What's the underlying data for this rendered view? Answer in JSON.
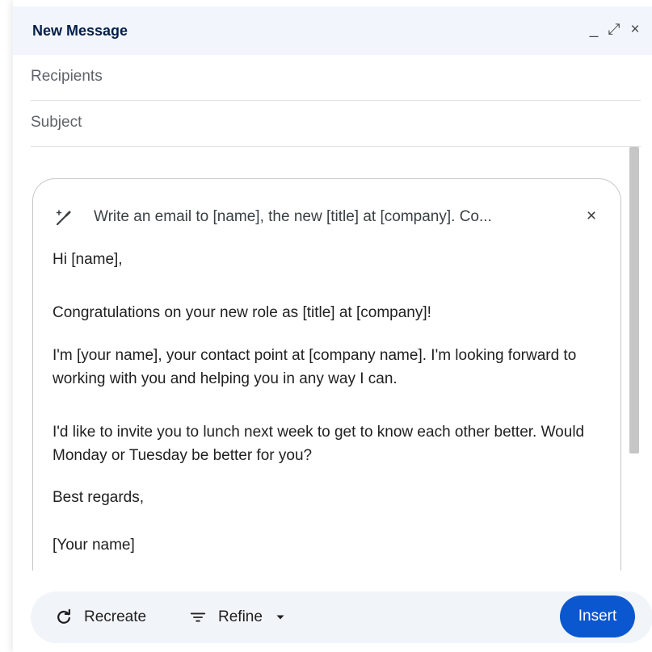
{
  "window": {
    "title": "New Message",
    "controls": {
      "minimize": "_",
      "expand": "⤢",
      "close": "×"
    }
  },
  "fields": {
    "recipients_placeholder": "Recipients",
    "subject_placeholder": "Subject"
  },
  "help_me_write": {
    "prompt": "Write an email to [name], the new [title] at [company]. Co...",
    "close": "×",
    "draft": [
      "Hi [name],",
      "Congratulations on your new role as [title] at [company]!",
      "I'm [your name], your contact point at [company name]. I'm looking forward to working with you and helping you in any way I can.",
      "I'd like to invite you to lunch next week to get to know each other better. Would Monday or Tuesday be better for you?",
      "Best regards,",
      "[Your name]"
    ]
  },
  "actions": {
    "recreate": "Recreate",
    "refine": "Refine",
    "insert": "Insert"
  },
  "icons": {
    "prompt": "magic-wand-pen-icon",
    "recreate": "refresh-icon",
    "refine": "filter-lines-icon",
    "refine_menu": "caret-down-icon"
  },
  "colors": {
    "titlebar_bg": "#f2f6fc",
    "title_text": "#041e49",
    "insert_bg": "#0b57d0",
    "actionbar_bg": "#f1f4f9"
  }
}
